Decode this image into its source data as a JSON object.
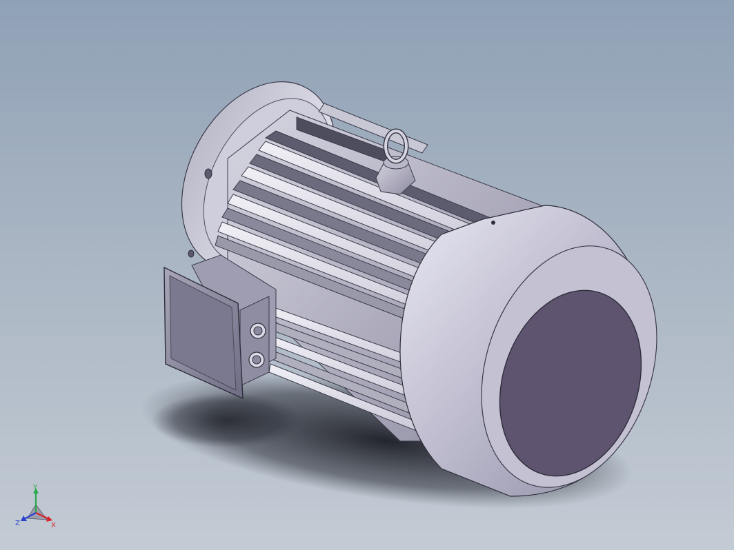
{
  "viewport": {
    "background_top": "#8fa1b6",
    "background_bottom": "#c3cbd4",
    "model": "motor-3d-model"
  },
  "triad": {
    "x_label": "X",
    "y_label": "Y",
    "z_label": "Z",
    "x_color": "#d8232a",
    "y_color": "#2aa84a",
    "z_color": "#2a3fd0"
  }
}
